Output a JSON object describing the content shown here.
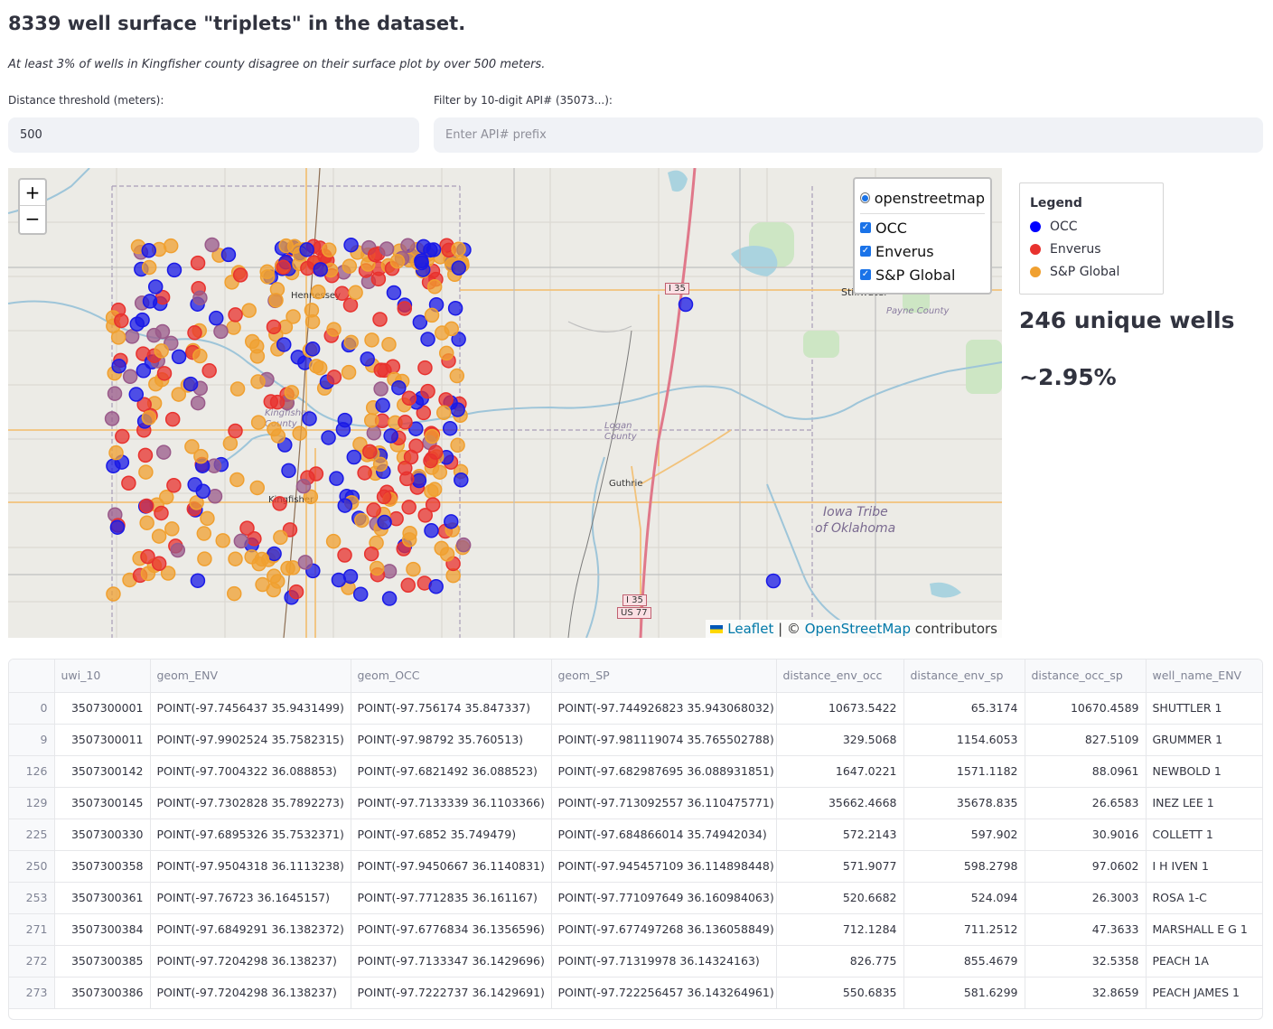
{
  "title": "8339 well surface \"triplets\" in the dataset.",
  "subtitle": "At least 3% of wells in Kingfisher county disagree on their surface plot by over 500 meters.",
  "distance": {
    "label": "Distance threshold (meters):",
    "value": "500"
  },
  "filter": {
    "label": "Filter by 10-digit API# (35073...):",
    "placeholder": "Enter API# prefix"
  },
  "map": {
    "zoom_in": "+",
    "zoom_out": "−",
    "base_layer": "openstreetmap",
    "overlays": [
      "OCC",
      "Enverus",
      "S&P Global"
    ],
    "labels": {
      "hennessey": "Hennessey",
      "kingfisher_county": "Kingfisher County",
      "kingfisher": "Kingfisher",
      "logan_county": "Logan County",
      "guthrie": "Guthrie",
      "stillwater": "Stillwater",
      "payne_county": "Payne County",
      "iowa_tribe_1": "Iowa Tribe",
      "iowa_tribe_2": "of Oklahoma",
      "i35_top": "I 35",
      "i35_bottom": "I 35",
      "us77": "US 77"
    },
    "attribution": {
      "leaflet": "Leaflet",
      "sep": " | © ",
      "osm": "OpenStreetMap",
      "contrib": " contributors"
    },
    "colors": {
      "occ": "#1a1ae6",
      "enverus": "#e8322e",
      "sp": "#f0a030"
    }
  },
  "legend": {
    "title": "Legend",
    "items": [
      {
        "label": "OCC",
        "color": "#0000ff"
      },
      {
        "label": "Enverus",
        "color": "#e8322e"
      },
      {
        "label": "S&P Global",
        "color": "#f0a030"
      }
    ]
  },
  "metrics": {
    "unique": "246 unique wells",
    "percent": "~2.95%"
  },
  "table": {
    "headers": [
      "",
      "uwi_10",
      "geom_ENV",
      "geom_OCC",
      "geom_SP",
      "distance_env_occ",
      "distance_env_sp",
      "distance_occ_sp",
      "well_name_ENV"
    ],
    "rows": [
      [
        "0",
        "3507300001",
        "POINT(-97.7456437 35.9431499)",
        "POINT(-97.756174 35.847337)",
        "POINT(-97.744926823 35.943068032)",
        "10673.5422",
        "65.3174",
        "10670.4589",
        "SHUTTLER 1"
      ],
      [
        "9",
        "3507300011",
        "POINT(-97.9902524 35.7582315)",
        "POINT(-97.98792 35.760513)",
        "POINT(-97.981119074 35.765502788)",
        "329.5068",
        "1154.6053",
        "827.5109",
        "GRUMMER 1"
      ],
      [
        "126",
        "3507300142",
        "POINT(-97.7004322 36.088853)",
        "POINT(-97.6821492 36.088523)",
        "POINT(-97.682987695 36.088931851)",
        "1647.0221",
        "1571.1182",
        "88.0961",
        "NEWBOLD 1"
      ],
      [
        "129",
        "3507300145",
        "POINT(-97.7302828 35.7892273)",
        "POINT(-97.7133339 36.1103366)",
        "POINT(-97.713092557 36.110475771)",
        "35662.4668",
        "35678.835",
        "26.6583",
        "INEZ LEE 1"
      ],
      [
        "225",
        "3507300330",
        "POINT(-97.6895326 35.7532371)",
        "POINT(-97.6852 35.749479)",
        "POINT(-97.684866014 35.74942034)",
        "572.2143",
        "597.902",
        "30.9016",
        "COLLETT 1"
      ],
      [
        "250",
        "3507300358",
        "POINT(-97.9504318 36.1113238)",
        "POINT(-97.9450667 36.1140831)",
        "POINT(-97.945457109 36.114898448)",
        "571.9077",
        "598.2798",
        "97.0602",
        "I H IVEN 1"
      ],
      [
        "253",
        "3507300361",
        "POINT(-97.76723 36.1645157)",
        "POINT(-97.7712835 36.161167)",
        "POINT(-97.771097649 36.160984063)",
        "520.6682",
        "524.094",
        "26.3003",
        "ROSA 1-C"
      ],
      [
        "271",
        "3507300384",
        "POINT(-97.6849291 36.1382372)",
        "POINT(-97.6776834 36.1356596)",
        "POINT(-97.677497268 36.136058849)",
        "712.1284",
        "711.2512",
        "47.3633",
        "MARSHALL E G 1"
      ],
      [
        "272",
        "3507300385",
        "POINT(-97.7204298 36.138237)",
        "POINT(-97.7133347 36.1429696)",
        "POINT(-97.71319978 36.14324163)",
        "826.775",
        "855.4679",
        "32.5358",
        "PEACH 1A"
      ],
      [
        "273",
        "3507300386",
        "POINT(-97.7204298 36.138237)",
        "POINT(-97.7222737 36.1429691)",
        "POINT(-97.722256457 36.143264961)",
        "550.6835",
        "581.6299",
        "32.8659",
        "PEACH JAMES 1"
      ]
    ]
  }
}
